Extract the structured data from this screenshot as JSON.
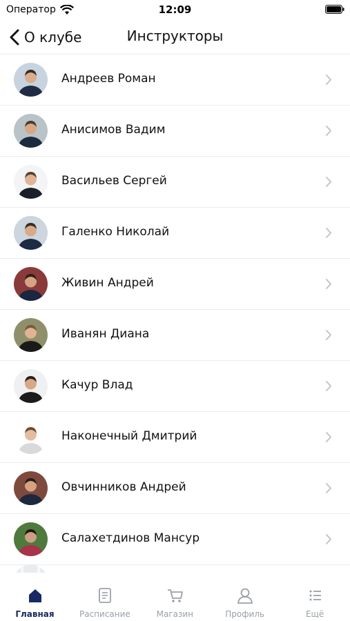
{
  "status_bar": {
    "carrier": "Оператор",
    "time": "12:09"
  },
  "nav": {
    "back_label": "О клубе",
    "title": "Инструкторы"
  },
  "instructors": [
    {
      "name": "Андреев Роман"
    },
    {
      "name": "Анисимов Вадим"
    },
    {
      "name": "Васильев Сергей"
    },
    {
      "name": "Галенко Николай"
    },
    {
      "name": "Живин Андрей"
    },
    {
      "name": "Иванян Диана"
    },
    {
      "name": "Качур Влад"
    },
    {
      "name": "Наконечный Дмитрий"
    },
    {
      "name": "Овчинников Андрей"
    },
    {
      "name": "Салахетдинов Мансур"
    }
  ],
  "tabs": [
    {
      "label": "Главная",
      "icon": "home-icon",
      "active": true
    },
    {
      "label": "Расписание",
      "icon": "schedule-icon",
      "active": false
    },
    {
      "label": "Магазин",
      "icon": "cart-icon",
      "active": false
    },
    {
      "label": "Профиль",
      "icon": "profile-icon",
      "active": false
    },
    {
      "label": "Ещё",
      "icon": "more-icon",
      "active": false
    }
  ],
  "colors": {
    "accent": "#172a63",
    "inactive": "#9aa0a8",
    "divider": "#ececec"
  }
}
